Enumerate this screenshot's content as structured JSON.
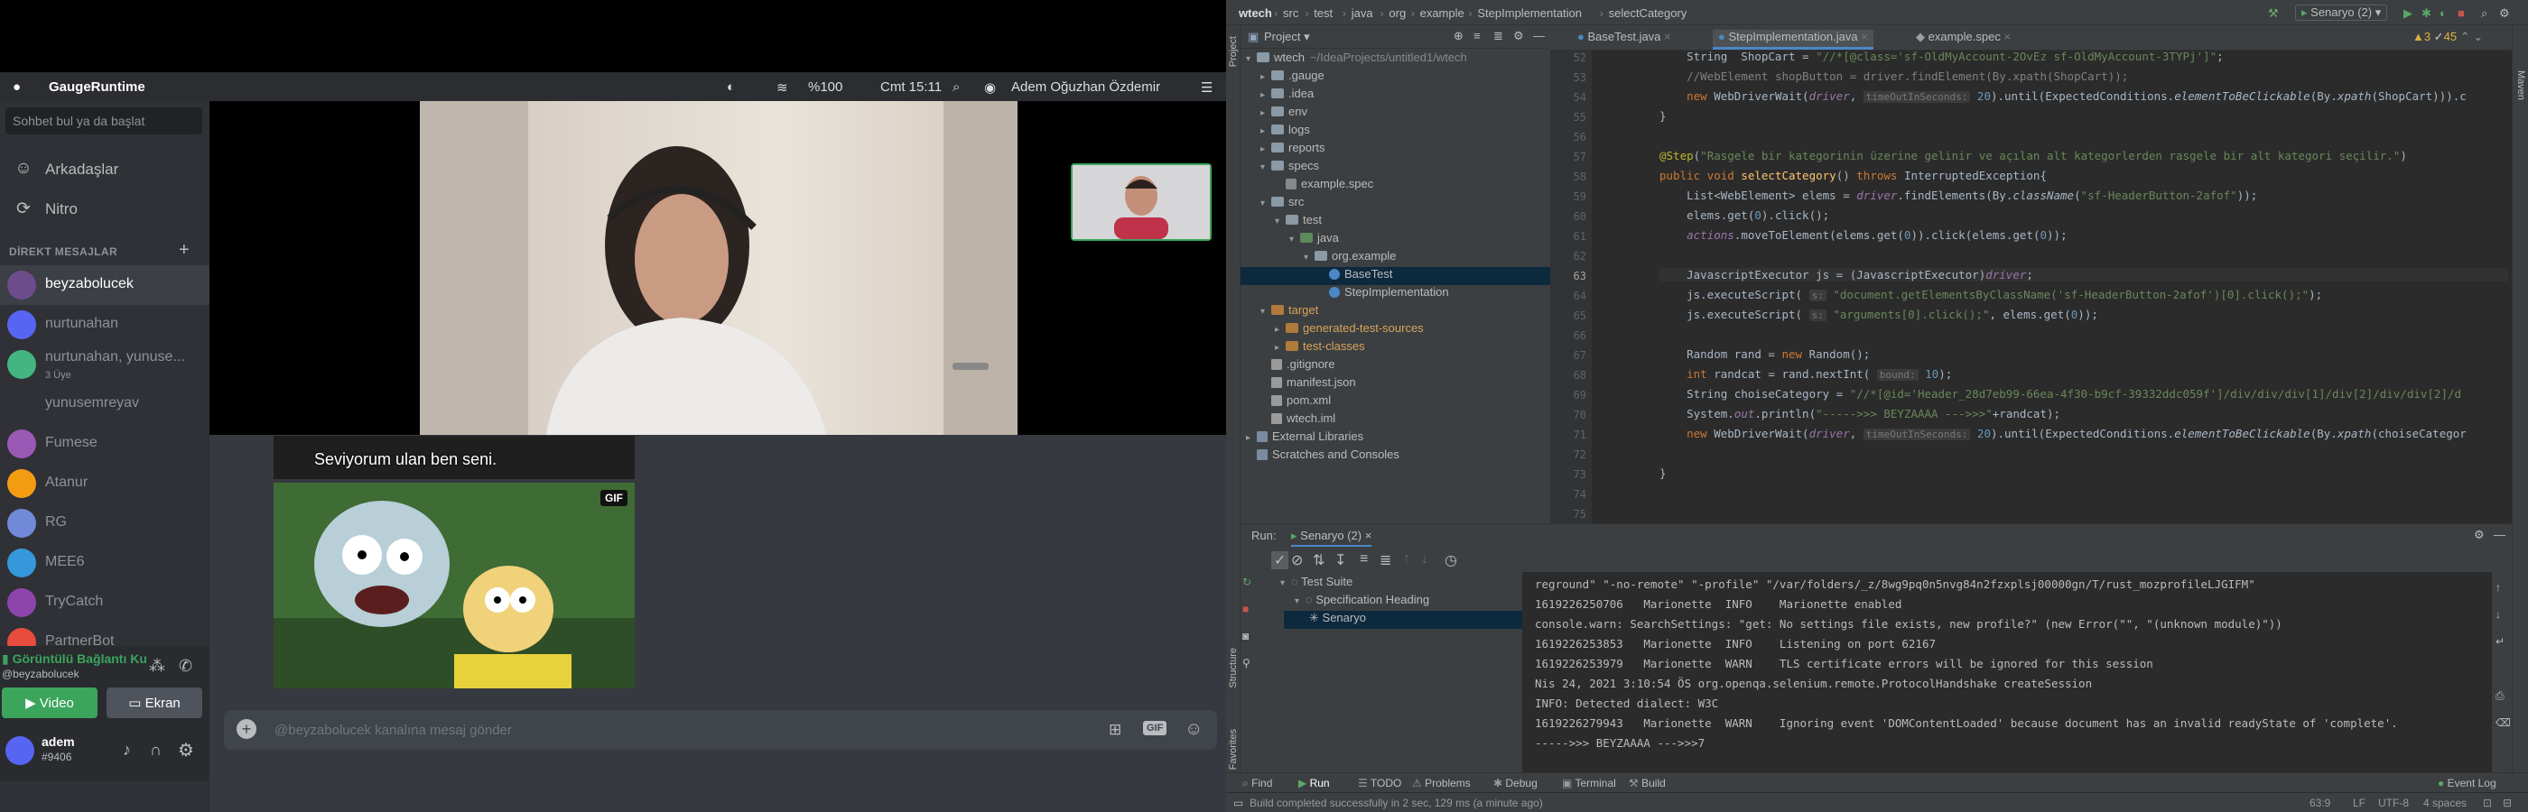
{
  "discord": {
    "menubar": {
      "app": "GaugeRuntime",
      "battery": "%100",
      "clock": "Cmt 15:11",
      "user": "Adem Oğuzhan Özdemir"
    },
    "search_placeholder": "Sohbet bul ya da başlat",
    "nav": [
      {
        "icon": "friends-icon",
        "label": "Arkadaşlar"
      },
      {
        "icon": "nitro-icon",
        "label": "Nitro"
      }
    ],
    "dm_header": "DİREKT MESAJLAR",
    "dms": [
      {
        "name": "beyzabolucek",
        "sub": "",
        "color": "#6d4c8c",
        "selected": true
      },
      {
        "name": "nurtunahan",
        "sub": "",
        "color": "#5865f2",
        "selected": false
      },
      {
        "name": "nurtunahan, yunuse...",
        "sub": "3 Üye",
        "color": "#43b581",
        "selected": false
      },
      {
        "name": "yunusemreyav",
        "sub": "",
        "color": "#2f3136",
        "selected": false
      },
      {
        "name": "Fumese",
        "sub": "",
        "color": "#9b59b6",
        "selected": false
      },
      {
        "name": "Atanur",
        "sub": "",
        "color": "#f39c12",
        "selected": false
      },
      {
        "name": "RG",
        "sub": "",
        "color": "#7289da",
        "selected": false
      },
      {
        "name": "MEE6",
        "sub": "",
        "color": "#3498db",
        "selected": false
      },
      {
        "name": "TryCatch",
        "sub": "",
        "color": "#8e44ad",
        "selected": false
      },
      {
        "name": "PartnerBot",
        "sub": "",
        "color": "#e74c3c",
        "selected": false
      }
    ],
    "voice": {
      "status": "Görüntülü Bağlantı Ku",
      "channel": "@beyzabolucek",
      "video_label": "Video",
      "screen_label": "Ekran"
    },
    "user": {
      "name": "adem",
      "tag": "#9406"
    },
    "chat": {
      "caption": "Seviyorum ulan ben seni.",
      "gif_badge": "GIF",
      "input_placeholder": "@beyzabolucek kanalına mesaj gönder",
      "gif_button": "GIF"
    }
  },
  "ide": {
    "breadcrumb": [
      "wtech",
      "src",
      "test",
      "java",
      "org",
      "example",
      "StepImplementation",
      "selectCategory"
    ],
    "run_config": "Senaryo (2)",
    "project_label": "Project",
    "tabs": [
      {
        "label": "BaseTest.java",
        "selected": false
      },
      {
        "label": "StepImplementation.java",
        "selected": true
      },
      {
        "label": "example.spec",
        "selected": false
      }
    ],
    "inspection": {
      "warnings": "3",
      "weak": "45"
    },
    "tree": [
      {
        "d": 0,
        "arrow": "▾",
        "kind": "fold",
        "label": "wtech",
        "extra": "~/IdeaProjects/untitled1/wtech",
        "sel": false
      },
      {
        "d": 1,
        "arrow": "▸",
        "kind": "fold",
        "label": ".gauge",
        "extra": "",
        "sel": false
      },
      {
        "d": 1,
        "arrow": "▸",
        "kind": "fold",
        "label": ".idea",
        "extra": "",
        "sel": false
      },
      {
        "d": 1,
        "arrow": "▸",
        "kind": "fold",
        "label": "env",
        "extra": "",
        "sel": false
      },
      {
        "d": 1,
        "arrow": "▸",
        "kind": "fold",
        "label": "logs",
        "extra": "",
        "sel": false
      },
      {
        "d": 1,
        "arrow": "▸",
        "kind": "fold",
        "label": "reports",
        "extra": "",
        "sel": false
      },
      {
        "d": 1,
        "arrow": "▾",
        "kind": "fold",
        "label": "specs",
        "extra": "",
        "sel": false
      },
      {
        "d": 2,
        "arrow": "",
        "kind": "spec",
        "label": "example.spec",
        "extra": "",
        "sel": false
      },
      {
        "d": 1,
        "arrow": "▾",
        "kind": "fold",
        "label": "src",
        "extra": "",
        "sel": false
      },
      {
        "d": 2,
        "arrow": "▾",
        "kind": "fold",
        "label": "test",
        "extra": "",
        "sel": false
      },
      {
        "d": 3,
        "arrow": "▾",
        "kind": "tst",
        "label": "java",
        "extra": "",
        "sel": false
      },
      {
        "d": 4,
        "arrow": "▾",
        "kind": "fold",
        "label": "org.example",
        "extra": "",
        "sel": false
      },
      {
        "d": 5,
        "arrow": "",
        "kind": "class",
        "label": "BaseTest",
        "extra": "",
        "sel": true
      },
      {
        "d": 5,
        "arrow": "",
        "kind": "class",
        "label": "StepImplementation",
        "extra": "",
        "sel": false
      },
      {
        "d": 1,
        "arrow": "▾",
        "kind": "org",
        "label": "target",
        "extra": "",
        "sel": false
      },
      {
        "d": 2,
        "arrow": "▸",
        "kind": "org",
        "label": "generated-test-sources",
        "extra": "",
        "sel": false
      },
      {
        "d": 2,
        "arrow": "▸",
        "kind": "org",
        "label": "test-classes",
        "extra": "",
        "sel": false
      },
      {
        "d": 1,
        "arrow": "",
        "kind": "file",
        "label": ".gitignore",
        "extra": "",
        "sel": false
      },
      {
        "d": 1,
        "arrow": "",
        "kind": "file",
        "label": "manifest.json",
        "extra": "",
        "sel": false
      },
      {
        "d": 1,
        "arrow": "",
        "kind": "file",
        "label": "pom.xml",
        "extra": "",
        "sel": false
      },
      {
        "d": 1,
        "arrow": "",
        "kind": "file",
        "label": "wtech.iml",
        "extra": "",
        "sel": false
      },
      {
        "d": 0,
        "arrow": "▸",
        "kind": "lib",
        "label": "External Libraries",
        "extra": "",
        "sel": false
      },
      {
        "d": 0,
        "arrow": "",
        "kind": "lib",
        "label": "Scratches and Consoles",
        "extra": "",
        "sel": false
      }
    ],
    "line_numbers": [
      "52",
      "53",
      "54",
      "55",
      "56",
      "57",
      "58",
      "59",
      "60",
      "61",
      "62",
      "63",
      "64",
      "65",
      "66",
      "67",
      "68",
      "69",
      "70",
      "71",
      "72",
      "73",
      "74",
      "75"
    ],
    "run": {
      "label": "Run:",
      "config": "Senaryo (2)",
      "tree": [
        "Test Suite",
        "Specification Heading",
        "Senaryo"
      ],
      "console": [
        "reground\" \"-no-remote\" \"-profile\" \"/var/folders/_z/8wg9pq0n5nvg84n2fzxplsj00000gn/T/rust_mozprofileLJGIFM\"",
        "1619226250706   Marionette  INFO    Marionette enabled",
        "console.warn: SearchSettings: \"get: No settings file exists, new profile?\" (new Error(\"\", \"(unknown module)\"))",
        "1619226253853   Marionette  INFO    Listening on port 62167",
        "1619226253979   Marionette  WARN    TLS certificate errors will be ignored for this session",
        "Nis 24, 2021 3:10:54 ÖS org.openqa.selenium.remote.ProtocolHandshake createSession",
        "INFO: Detected dialect: W3C",
        "1619226279943   Marionette  WARN    Ignoring event 'DOMContentLoaded' because document has an invalid readyState of 'complete'.",
        "----->>> BEYZAAAA --->>>7"
      ]
    },
    "bottom_tools": [
      "Find",
      "Run",
      "TODO",
      "Problems",
      "Debug",
      "Terminal",
      "Build",
      "Event Log"
    ],
    "status_left": "Build completed successfully in 2 sec, 129 ms (a minute ago)",
    "status_right": [
      "63:9",
      "LF",
      "UTF-8",
      "4 spaces"
    ],
    "side_labels": [
      "Project",
      "Structure",
      "Favorites",
      "Maven"
    ]
  }
}
